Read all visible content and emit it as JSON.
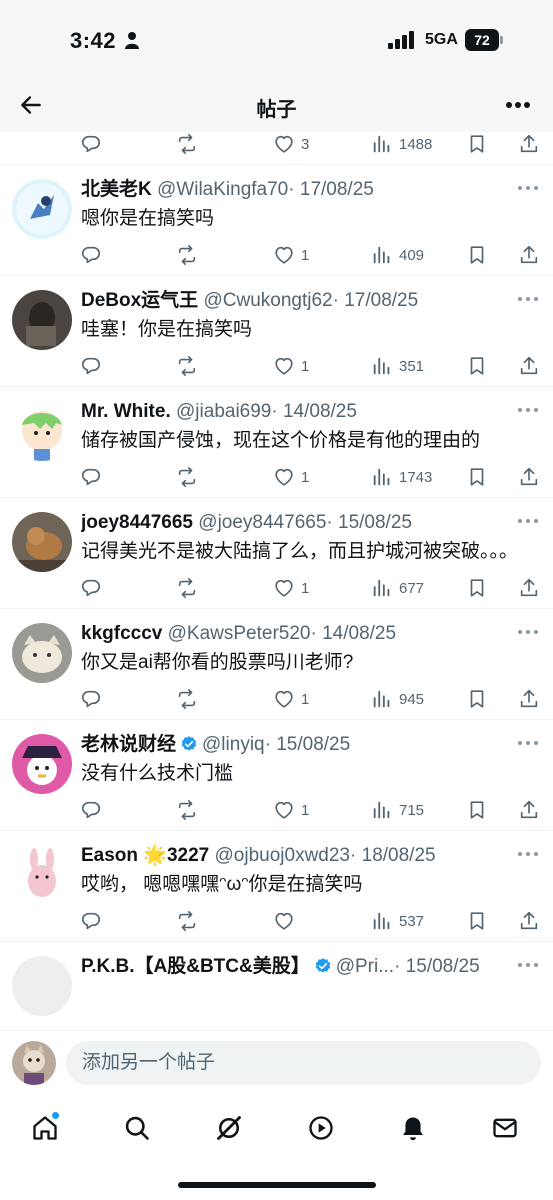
{
  "status": {
    "time": "3:42",
    "network": "5GA",
    "battery": "72"
  },
  "header": {
    "title": "帖子"
  },
  "top_stats": {
    "like_count": "3",
    "view_count": "1488"
  },
  "tweets": [
    {
      "name": "北美老K",
      "handle": "@WilaKingfa70",
      "date": "· 17/08/25",
      "text": "嗯你是在搞笑吗",
      "likes": "1",
      "views": "409",
      "verified": false
    },
    {
      "name": "DeBox运气王",
      "handle": "@Cwukongtj62",
      "date": "· 17/08/25",
      "text": "哇塞！你是在搞笑吗",
      "likes": "1",
      "views": "351",
      "verified": false
    },
    {
      "name": "Mr. White.",
      "handle": "@jiabai699",
      "date": "· 14/08/25",
      "text": "储存被国产侵蚀，现在这个价格是有他的理由的",
      "likes": "1",
      "views": "1743",
      "verified": false
    },
    {
      "name": "joey8447665",
      "handle": "@joey8447665",
      "date": "· 15/08/25",
      "text": "记得美光不是被大陆搞了么，而且护城河被突破。。。",
      "likes": "1",
      "views": "677",
      "verified": false
    },
    {
      "name": "kkgfcccv",
      "handle": "@KawsPeter520",
      "date": "· 14/08/25",
      "text": "你又是ai帮你看的股票吗川老师?",
      "likes": "1",
      "views": "945",
      "verified": false
    },
    {
      "name": "老林说财经",
      "handle": "@linyiq",
      "date": "· 15/08/25",
      "text": "没有什么技术门槛",
      "likes": "1",
      "views": "715",
      "verified": true
    },
    {
      "name": "Eason 🌟3227",
      "handle": "@ojbuoj0xwd23",
      "date": "· 18/08/25",
      "text": "哎哟， 嗯嗯嘿嘿ᵔωᵔ你是在搞笑吗",
      "likes": "",
      "views": "537",
      "verified": false
    },
    {
      "name": "P.K.B.【A股&BTC&美股】",
      "handle": "@Pri...",
      "date": "· 15/08/25",
      "text": "",
      "likes": "",
      "views": "",
      "verified": true
    }
  ],
  "composer": {
    "placeholder": "添加另一个帖子"
  },
  "colors": {
    "accent": "#1d9bf0",
    "secondary_text": "#536471",
    "divider": "#eff3f4"
  },
  "icons": [
    "back-arrow-icon",
    "more-icon",
    "reply-icon",
    "retweet-icon",
    "like-icon",
    "views-icon",
    "bookmark-icon",
    "share-icon",
    "home-icon",
    "search-icon",
    "grok-icon",
    "video-icon",
    "notifications-icon",
    "messages-icon",
    "verified-icon"
  ]
}
